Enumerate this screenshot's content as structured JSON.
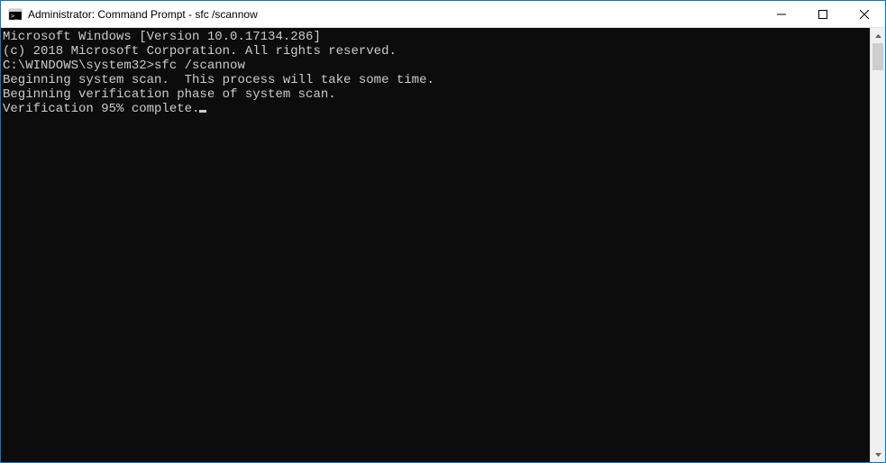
{
  "titlebar": {
    "title": "Administrator: Command Prompt - sfc  /scannow"
  },
  "console": {
    "line1": "Microsoft Windows [Version 10.0.17134.286]",
    "line2": "(c) 2018 Microsoft Corporation. All rights reserved.",
    "blank1": "",
    "prompt_prefix": "C:\\WINDOWS\\system32>",
    "command": "sfc /scannow",
    "blank2": "",
    "line3": "Beginning system scan.  This process will take some time.",
    "blank3": "",
    "line4": "Beginning verification phase of system scan.",
    "line5": "Verification 95% complete."
  }
}
